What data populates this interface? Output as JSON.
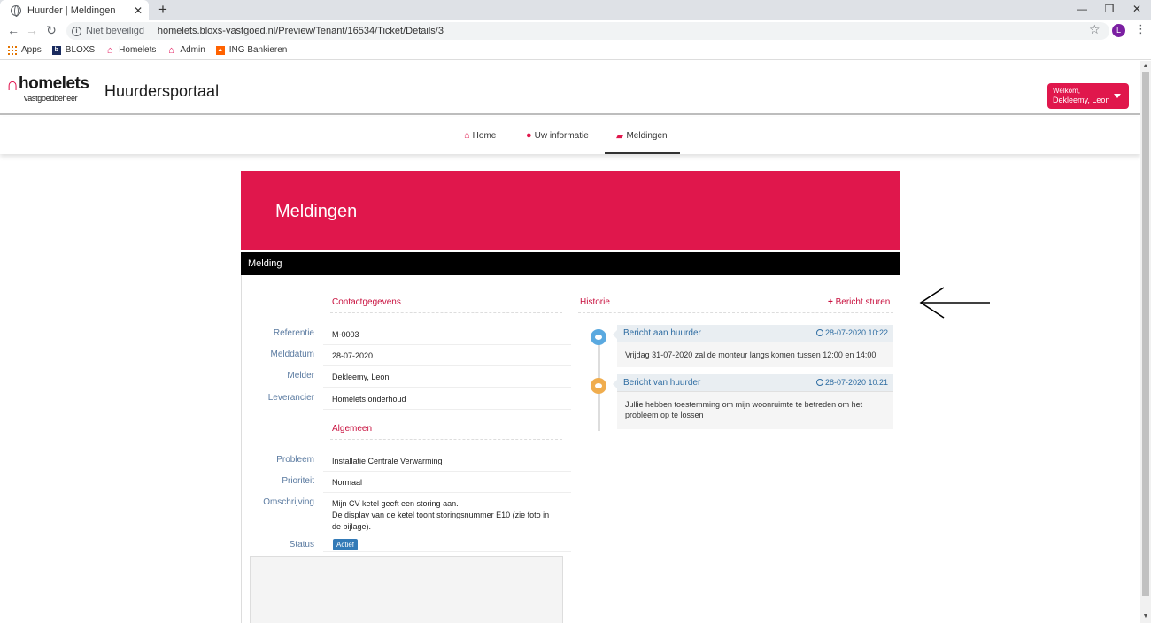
{
  "browser": {
    "tab_title": "Huurder | Meldingen",
    "security_label": "Niet beveiligd",
    "url": "homelets.bloxs-vastgoed.nl/Preview/Tenant/16534/Ticket/Details/3",
    "profile_initial": "L",
    "bookmarks": [
      {
        "label": "Apps"
      },
      {
        "label": "BLOXS"
      },
      {
        "label": "Homelets"
      },
      {
        "label": "Admin"
      },
      {
        "label": "ING Bankieren"
      }
    ]
  },
  "header": {
    "logo_text": "homelets",
    "logo_sub": "vastgoedbeheer",
    "portal_title": "Huurdersportaal",
    "welcome_label": "Welkom,",
    "user_name": "Dekleemy, Leon"
  },
  "nav": {
    "items": [
      {
        "label": "Home"
      },
      {
        "label": "Uw informatie"
      },
      {
        "label": "Meldingen"
      }
    ]
  },
  "hero": {
    "title": "Meldingen"
  },
  "panel": {
    "title": "Melding",
    "contact_section": "Contactgegevens",
    "general_section": "Algemeen",
    "fields": {
      "referentie": {
        "label": "Referentie",
        "value": "M-0003"
      },
      "melddatum": {
        "label": "Melddatum",
        "value": "28-07-2020"
      },
      "melder": {
        "label": "Melder",
        "value": "Dekleemy, Leon"
      },
      "leverancier": {
        "label": "Leverancier",
        "value": "Homelets onderhoud"
      },
      "probleem": {
        "label": "Probleem",
        "value": "Installatie Centrale Verwarming"
      },
      "prioriteit": {
        "label": "Prioriteit",
        "value": "Normaal"
      },
      "omschrijving": {
        "label": "Omschrijving",
        "line1": "Mijn CV ketel geeft een storing aan.",
        "line2": "De display van de ketel toont storingsnummer E10 (zie foto in",
        "line3": "de bijlage)."
      },
      "status": {
        "label": "Status",
        "value": "Actief"
      }
    },
    "history_section": "Historie",
    "send_message": "Bericht sturen",
    "history": [
      {
        "who": "Bericht aan huurder",
        "when": "28-07-2020 10:22",
        "message": "Vrijdag 31-07-2020 zal de monteur langs komen tussen 12:00 en 14:00",
        "dot_color": "#5aa9e0"
      },
      {
        "who": "Bericht van huurder",
        "when": "28-07-2020 10:21",
        "message_line1": "Jullie hebben toestemming om mijn woonruimte te betreden om het",
        "message_line2": "probleem op te lossen",
        "dot_color": "#f0ad4e"
      }
    ]
  },
  "colors": {
    "brand": "#e0174c",
    "section_text": "#c8103e",
    "label_text": "#5a7aa0",
    "status_badge": "#337ab7"
  }
}
